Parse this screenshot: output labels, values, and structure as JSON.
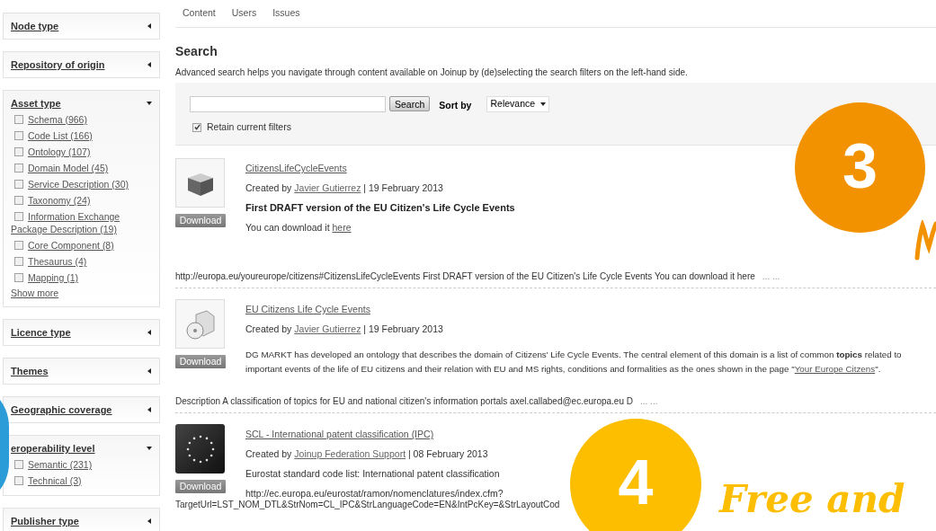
{
  "tabs": [
    {
      "label": "Content",
      "selected": false
    },
    {
      "label": "Users",
      "selected": false
    },
    {
      "label": "Issues",
      "selected": false
    }
  ],
  "facets": [
    {
      "title": "Node type",
      "expanded": false
    },
    {
      "title": "Repository of origin",
      "expanded": false
    },
    {
      "title": "Asset type",
      "expanded": true,
      "show_more": "Show more",
      "options": [
        {
          "label": "Schema (966)",
          "checked": false
        },
        {
          "label": "Code List (166)",
          "checked": false
        },
        {
          "label": "Ontology (107)",
          "checked": false
        },
        {
          "label": "Domain Model (45)",
          "checked": false
        },
        {
          "label": "Service Description (30)",
          "checked": false
        },
        {
          "label": "Taxonomy (24)",
          "checked": false
        },
        {
          "label": "Information Exchange",
          "continuation": "Package Description (19)",
          "checked": false
        },
        {
          "label": "Core Component (8)",
          "checked": false
        },
        {
          "label": "Thesaurus (4)",
          "checked": false
        },
        {
          "label": "Mapping (1)",
          "checked": false
        }
      ]
    },
    {
      "title": "Licence type",
      "expanded": false
    },
    {
      "title": "Themes",
      "expanded": false
    },
    {
      "title": "Geographic coverage",
      "expanded": false
    },
    {
      "title": "eroperability level",
      "expanded": true,
      "options": [
        {
          "label": "Semantic (231)",
          "checked": false
        },
        {
          "label": "Technical (3)",
          "checked": false
        }
      ]
    },
    {
      "title": "Publisher type",
      "expanded": false
    }
  ],
  "search": {
    "heading": "Search",
    "intro": "Advanced search helps you navigate through content available on Joinup by (de)selecting the search filters on the left-hand side.",
    "button": "Search",
    "sort_label": "Sort by",
    "sort_value": "Relevance",
    "retain_label": "Retain current filters",
    "retain_checked": true
  },
  "results": [
    {
      "kind": "box",
      "title": "CitizensLifeCycleEvents",
      "download": "Download",
      "created_prefix": "Created by",
      "author": "Javier Gutierrez",
      "date": "| 19 February 2013",
      "body": [
        {
          "kind": "bold",
          "text": "First DRAFT version of the EU Citizen's Life Cycle Events"
        },
        {
          "kind": "link_line",
          "text": "You can download it",
          "link": "here"
        }
      ],
      "snippet": "http://europa.eu/youreurope/citizens#CitizensLifeCycleEvents First DRAFT version of the EU Citizen's Life Cycle Events You can download it here",
      "more": "... ..."
    },
    {
      "kind": "disc",
      "title": "EU Citizens Life Cycle Events",
      "download": "Download",
      "created_prefix": "Created by",
      "author": "Javier Gutierrez",
      "date": "| 19 February 2013",
      "body": [
        {
          "kind": "paragraph",
          "text": "DG MARKT has developed an ontology that describes the domain of Citizens' Life Cycle Events. The central element of this domain is a list of common **topics** related to",
          "text2": "important events of the life of EU citizens and their relation with EU and MS rights, conditions and formalities as the ones shown in the page \"",
          "link": "Your Europe Citzens",
          "after": "\"."
        }
      ],
      "snippet": "Description A classification of topics for EU and national citizen's information portals axel.callabed@ec.europa.eu D",
      "more": "... ..."
    },
    {
      "kind": "stars",
      "title": "SCL - International patent classification (IPC)",
      "download": "Download",
      "created_prefix": "Created by",
      "author": "Joinup Federation Support",
      "date": "| 08 February 2013",
      "body": [
        {
          "kind": "plain",
          "text": "Eurostat standard code list: International patent classification"
        },
        {
          "kind": "plain",
          "text": "http://ec.europa.eu/eurostat/ramon/nomenclatures/index.cfm?"
        }
      ],
      "snippet": "TargetUrl=LST_NOM_DTL&StrNom=CL_IPC&StrLanguageCode=EN&IntPcKey=&StrLayoutCod"
    }
  ],
  "overlays": [
    {
      "kind": "badge",
      "text": "3",
      "color": "#f39200"
    },
    {
      "kind": "squiggle",
      "color": "#f39200"
    },
    {
      "kind": "badge",
      "text": "4",
      "color": "#fdbe00"
    },
    {
      "kind": "script",
      "text": "Free and",
      "color": "#fdbe00"
    },
    {
      "kind": "blob",
      "color": "#2b9cd8"
    }
  ]
}
